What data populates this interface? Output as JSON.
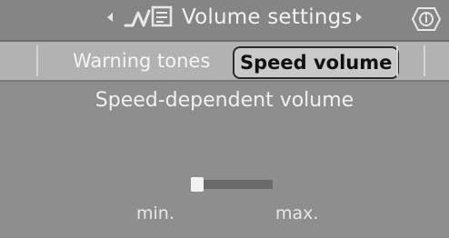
{
  "header": {
    "title": "Volume settings",
    "left_arrow_icon": "chevron-left-icon",
    "right_arrow_icon": "chevron-right-icon",
    "menu_icon": "audio-settings-icon",
    "info_icon": "info-icon"
  },
  "tabs": [
    {
      "label": "Warning tones",
      "selected": false
    },
    {
      "label": "Speed volume",
      "selected": true
    }
  ],
  "main": {
    "title": "Speed-dependent volume",
    "slider": {
      "min_label": "min.",
      "max_label": "max.",
      "level": 0.0
    }
  },
  "colors": {
    "background": "#8f8f8f",
    "tab_bar": "#b2b2b2",
    "selected_tab_border": "#2a2a2a",
    "text": "#eeeeee"
  }
}
